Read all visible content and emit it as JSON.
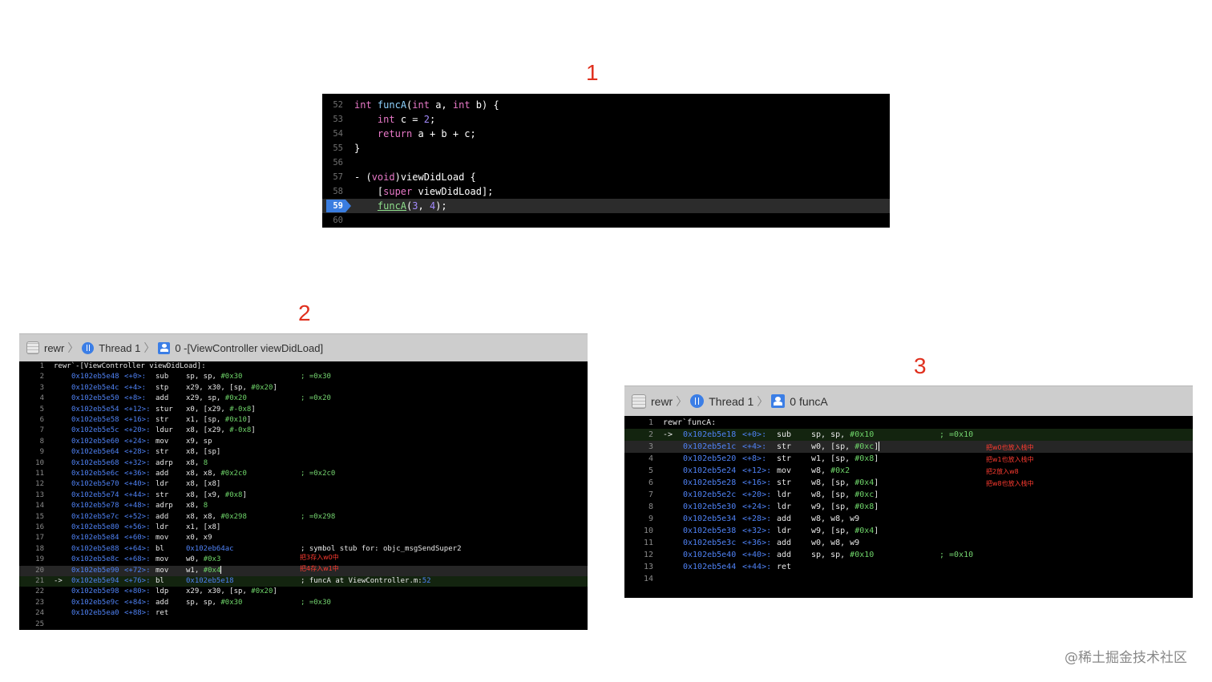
{
  "labels": [
    "1",
    "2",
    "3"
  ],
  "editor": {
    "lines": [
      {
        "n": "52",
        "code": [
          [
            "int",
            "kw"
          ],
          [
            " ",
            ""
          ],
          [
            "funcA",
            "fn"
          ],
          [
            "(",
            ""
          ],
          [
            "int",
            "kw"
          ],
          [
            " a, ",
            ""
          ],
          [
            "int",
            "kw"
          ],
          [
            " b) {",
            ""
          ]
        ]
      },
      {
        "n": "53",
        "code": [
          [
            "    ",
            ""
          ],
          [
            "int",
            "kw"
          ],
          [
            " c = ",
            ""
          ],
          [
            "2",
            "num"
          ],
          [
            ";",
            ""
          ]
        ]
      },
      {
        "n": "54",
        "code": [
          [
            "    ",
            ""
          ],
          [
            "return",
            "kw"
          ],
          [
            " a + b + c;",
            ""
          ]
        ]
      },
      {
        "n": "55",
        "code": [
          [
            "}",
            ""
          ]
        ]
      },
      {
        "n": "56",
        "code": []
      },
      {
        "n": "57",
        "code": [
          [
            "- (",
            ""
          ],
          [
            "void",
            "kw"
          ],
          [
            ")viewDidLoad {",
            ""
          ]
        ]
      },
      {
        "n": "58",
        "code": [
          [
            "    [",
            ""
          ],
          [
            "super",
            "kw"
          ],
          [
            " viewDidLoad];",
            ""
          ]
        ]
      },
      {
        "n": "59",
        "code": [
          [
            "    ",
            ""
          ],
          [
            "funcA",
            "fncall"
          ],
          [
            "(",
            ""
          ],
          [
            "3",
            "num"
          ],
          [
            ", ",
            ""
          ],
          [
            "4",
            "num"
          ],
          [
            ");",
            ""
          ]
        ],
        "breakpoint": true
      },
      {
        "n": "60",
        "code": []
      }
    ]
  },
  "panel2": {
    "breadcrumb": {
      "project": "rewr",
      "thread": "Thread 1",
      "frame": "0 -[ViewController viewDidLoad]"
    },
    "lines": [
      {
        "n": "1",
        "text": "rewr`-[ViewController viewDidLoad]:"
      },
      {
        "n": "2",
        "addr": "0x102eb5e48",
        "off": "<+0>:",
        "op": "sub",
        "args": "sp, sp, ",
        "imm": "#0x30",
        "cmt": "; =0x30"
      },
      {
        "n": "3",
        "addr": "0x102eb5e4c",
        "off": "<+4>:",
        "op": "stp",
        "args": "x29, x30, [sp, ",
        "imm": "#0x20",
        "post": "]"
      },
      {
        "n": "4",
        "addr": "0x102eb5e50",
        "off": "<+8>:",
        "op": "add",
        "args": "x29, sp, ",
        "imm": "#0x20",
        "cmt": "; =0x20"
      },
      {
        "n": "5",
        "addr": "0x102eb5e54",
        "off": "<+12>:",
        "op": "stur",
        "args": "x0, [x29, ",
        "imm": "#-0x8",
        "post": "]"
      },
      {
        "n": "6",
        "addr": "0x102eb5e58",
        "off": "<+16>:",
        "op": "str",
        "args": "x1, [sp, ",
        "imm": "#0x10",
        "post": "]"
      },
      {
        "n": "7",
        "addr": "0x102eb5e5c",
        "off": "<+20>:",
        "op": "ldur",
        "args": "x8, [x29, ",
        "imm": "#-0x8",
        "post": "]"
      },
      {
        "n": "8",
        "addr": "0x102eb5e60",
        "off": "<+24>:",
        "op": "mov",
        "args": "x9, sp"
      },
      {
        "n": "9",
        "addr": "0x102eb5e64",
        "off": "<+28>:",
        "op": "str",
        "args": "x8, [sp]"
      },
      {
        "n": "10",
        "addr": "0x102eb5e68",
        "off": "<+32>:",
        "op": "adrp",
        "args": "x8, ",
        "imm": "8"
      },
      {
        "n": "11",
        "addr": "0x102eb5e6c",
        "off": "<+36>:",
        "op": "add",
        "args": "x8, x8, ",
        "imm": "#0x2c0",
        "cmt": "; =0x2c0"
      },
      {
        "n": "12",
        "addr": "0x102eb5e70",
        "off": "<+40>:",
        "op": "ldr",
        "args": "x8, [x8]"
      },
      {
        "n": "13",
        "addr": "0x102eb5e74",
        "off": "<+44>:",
        "op": "str",
        "args": "x8, [x9, ",
        "imm": "#0x8",
        "post": "]"
      },
      {
        "n": "14",
        "addr": "0x102eb5e78",
        "off": "<+48>:",
        "op": "adrp",
        "args": "x8, ",
        "imm": "8"
      },
      {
        "n": "15",
        "addr": "0x102eb5e7c",
        "off": "<+52>:",
        "op": "add",
        "args": "x8, x8, ",
        "imm": "#0x298",
        "cmt": "; =0x298"
      },
      {
        "n": "16",
        "addr": "0x102eb5e80",
        "off": "<+56>:",
        "op": "ldr",
        "args": "x1, [x8]"
      },
      {
        "n": "17",
        "addr": "0x102eb5e84",
        "off": "<+60>:",
        "op": "mov",
        "args": "x0, x9"
      },
      {
        "n": "18",
        "addr": "0x102eb5e88",
        "off": "<+64>:",
        "op": "bl",
        "addrarg": "0x102eb64ac",
        "cmtw": "; symbol stub for: objc_msgSendSuper2"
      },
      {
        "n": "19",
        "addr": "0x102eb5e8c",
        "off": "<+68>:",
        "op": "mov",
        "args": "w0, ",
        "imm": "#0x3",
        "cn": "把3存入w0中"
      },
      {
        "n": "20",
        "addr": "0x102eb5e90",
        "off": "<+72>:",
        "op": "mov",
        "args": "w1, ",
        "imm": "#0x4",
        "cn": "把4存入w1中",
        "hl": true,
        "cursor": true
      },
      {
        "n": "21",
        "arrow": "->",
        "addr": "0x102eb5e94",
        "off": "<+76>:",
        "op": "bl",
        "addrarg": "0x102eb5e18",
        "cmtw": "; funcA at ViewController.m:",
        "cmtnum": "52",
        "cur": true
      },
      {
        "n": "22",
        "addr": "0x102eb5e98",
        "off": "<+80>:",
        "op": "ldp",
        "args": "x29, x30, [sp, ",
        "imm": "#0x20",
        "post": "]"
      },
      {
        "n": "23",
        "addr": "0x102eb5e9c",
        "off": "<+84>:",
        "op": "add",
        "args": "sp, sp, ",
        "imm": "#0x30",
        "cmt": "; =0x30"
      },
      {
        "n": "24",
        "addr": "0x102eb5ea0",
        "off": "<+88>:",
        "op": "ret"
      },
      {
        "n": "25"
      }
    ]
  },
  "panel3": {
    "breadcrumb": {
      "project": "rewr",
      "thread": "Thread 1",
      "frame": "0 funcA"
    },
    "lines": [
      {
        "n": "1",
        "text": "rewr`funcA:"
      },
      {
        "n": "2",
        "arrow": "->",
        "addr": "0x102eb5e18",
        "off": "<+0>:",
        "op": "sub",
        "args": "sp, sp, ",
        "imm": "#0x10",
        "cmt": "; =0x10",
        "cur": true
      },
      {
        "n": "3",
        "addr": "0x102eb5e1c",
        "off": "<+4>:",
        "op": "str",
        "args": "w0, [sp, ",
        "imm": "#0xc",
        "post": "]",
        "cn": "把w0也放入栈中",
        "hl": true,
        "cursor": true
      },
      {
        "n": "4",
        "addr": "0x102eb5e20",
        "off": "<+8>:",
        "op": "str",
        "args": "w1, [sp, ",
        "imm": "#0x8",
        "post": "]",
        "cn": "把w1也放入栈中"
      },
      {
        "n": "5",
        "addr": "0x102eb5e24",
        "off": "<+12>:",
        "op": "mov",
        "args": "w8, ",
        "imm": "#0x2",
        "cn": "把2放入w8"
      },
      {
        "n": "6",
        "addr": "0x102eb5e28",
        "off": "<+16>:",
        "op": "str",
        "args": "w8, [sp, ",
        "imm": "#0x4",
        "post": "]",
        "cn": "把w8也放入栈中"
      },
      {
        "n": "7",
        "addr": "0x102eb5e2c",
        "off": "<+20>:",
        "op": "ldr",
        "args": "w8, [sp, ",
        "imm": "#0xc",
        "post": "]"
      },
      {
        "n": "8",
        "addr": "0x102eb5e30",
        "off": "<+24>:",
        "op": "ldr",
        "args": "w9, [sp, ",
        "imm": "#0x8",
        "post": "]"
      },
      {
        "n": "9",
        "addr": "0x102eb5e34",
        "off": "<+28>:",
        "op": "add",
        "args": "w8, w8, w9"
      },
      {
        "n": "10",
        "addr": "0x102eb5e38",
        "off": "<+32>:",
        "op": "ldr",
        "args": "w9, [sp, ",
        "imm": "#0x4",
        "post": "]"
      },
      {
        "n": "11",
        "addr": "0x102eb5e3c",
        "off": "<+36>:",
        "op": "add",
        "args": "w0, w8, w9"
      },
      {
        "n": "12",
        "addr": "0x102eb5e40",
        "off": "<+40>:",
        "op": "add",
        "args": "sp, sp, ",
        "imm": "#0x10",
        "cmt": "; =0x10"
      },
      {
        "n": "13",
        "addr": "0x102eb5e44",
        "off": "<+44>:",
        "op": "ret"
      },
      {
        "n": "14"
      }
    ]
  },
  "watermark": "@稀土掘金技术社区"
}
